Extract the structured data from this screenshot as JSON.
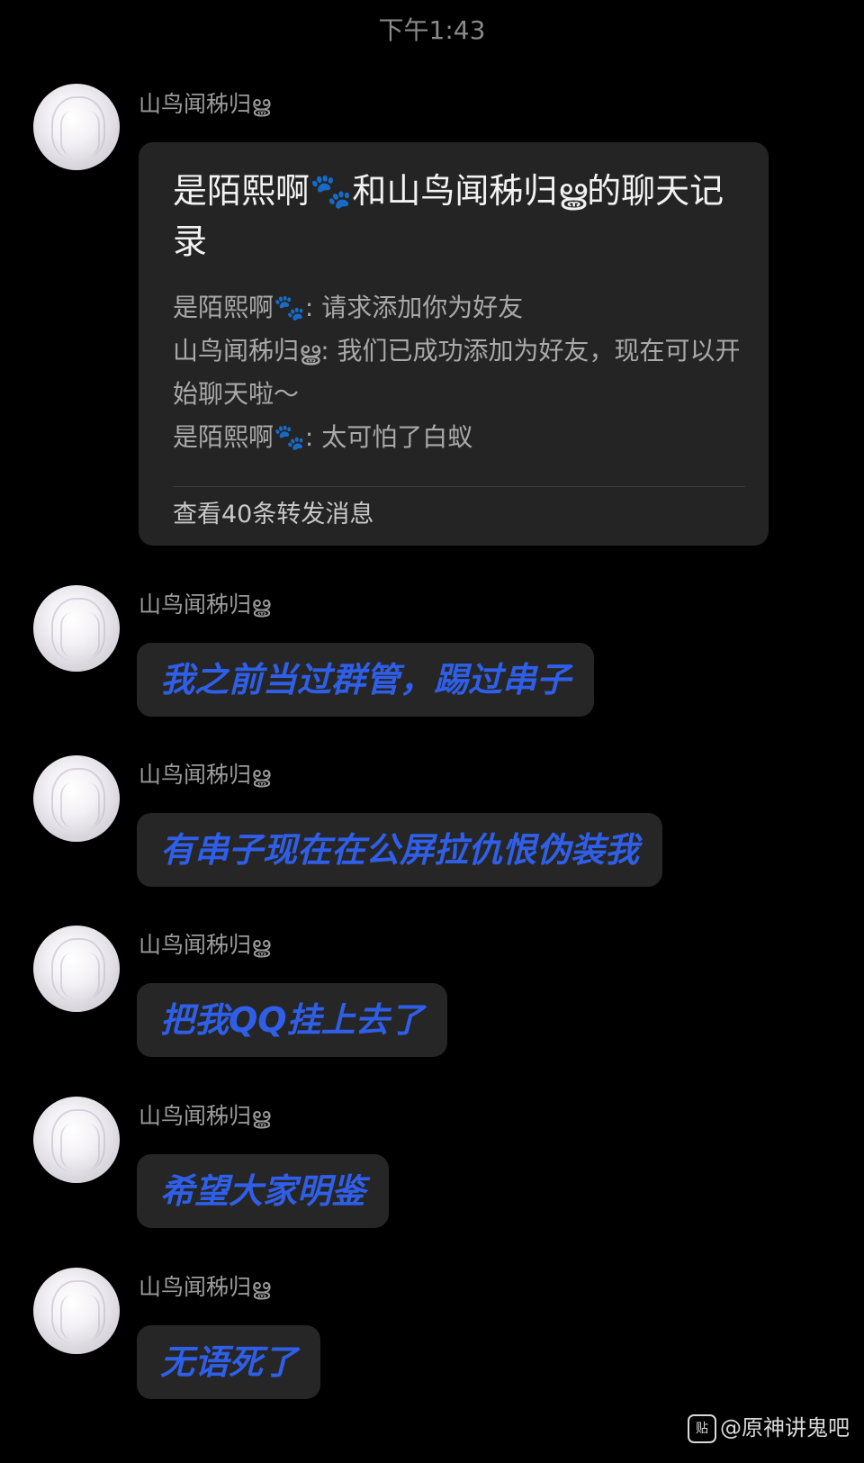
{
  "timestamp": "下午1:43",
  "forward_card": {
    "sender": "山鸟闻秭归ൠ",
    "title": "是陌熙啊🐾和山鸟闻秭归ൠ的聊天记录",
    "lines": [
      "是陌熙啊🐾: 请求添加你为好友",
      "山鸟闻秭归ൠ: 我们已成功添加为好友，现在可以开始聊天啦～",
      "是陌熙啊🐾: 太可怕了白蚁"
    ],
    "footer": "查看40条转发消息"
  },
  "messages": [
    {
      "sender": "山鸟闻秭归ൠ",
      "text": "我之前当过群管，踢过串子"
    },
    {
      "sender": "山鸟闻秭归ൠ",
      "text": "有串子现在在公屏拉仇恨伪装我"
    },
    {
      "sender": "山鸟闻秭归ൠ",
      "text": "把我QQ挂上去了"
    },
    {
      "sender": "山鸟闻秭归ൠ",
      "text": "希望大家明鉴"
    },
    {
      "sender": "山鸟闻秭归ൠ",
      "text": "无语死了"
    }
  ],
  "watermark": {
    "icon": "tieba-icon",
    "text": "@原神讲鬼吧"
  },
  "colors": {
    "background": "#000000",
    "bubble": "#262626",
    "bubble_text": "#2f5fe8",
    "sender_text": "#9a9a9a"
  }
}
